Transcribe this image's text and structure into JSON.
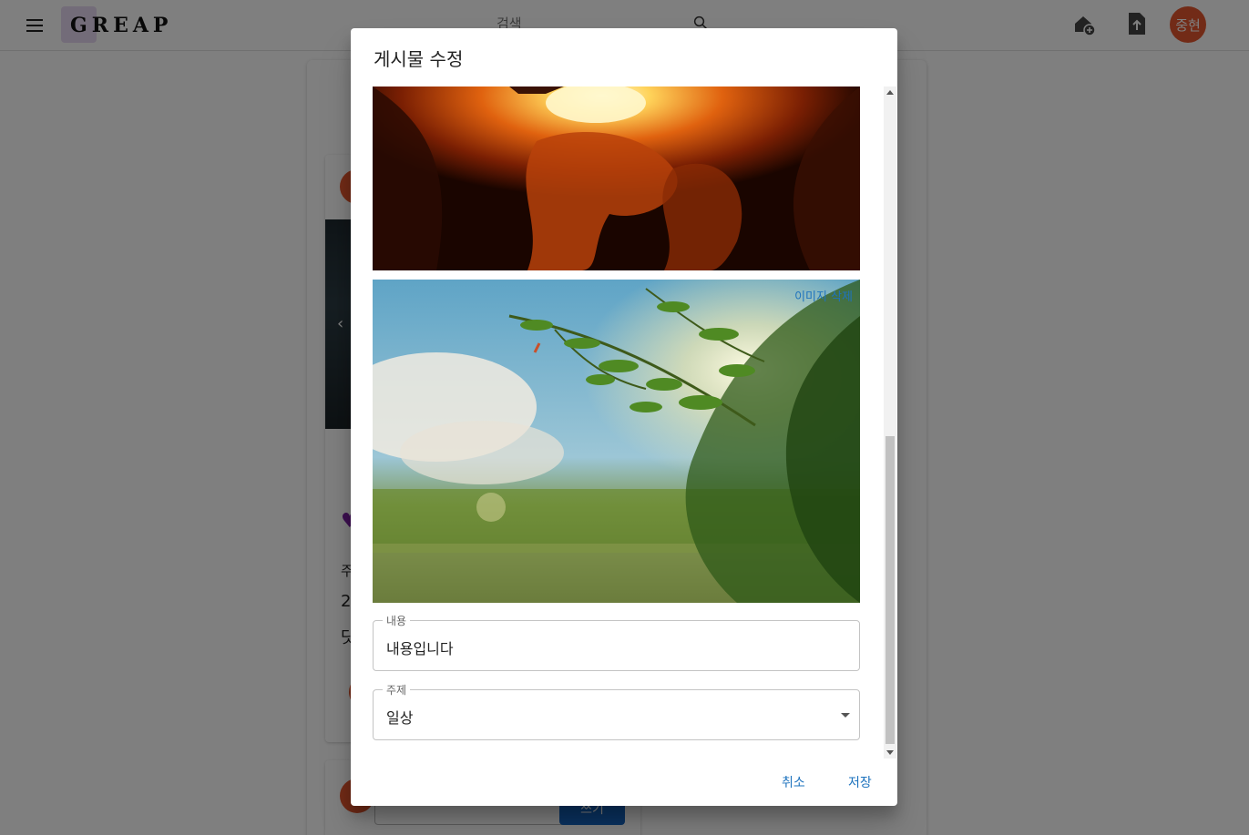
{
  "appbar": {
    "logo": "GREAP",
    "search_placeholder": "검색",
    "avatar_label": "중현"
  },
  "background": {
    "card_text_lines": [
      "주",
      "2",
      "닷"
    ],
    "comment_button": "쓰기"
  },
  "dialog": {
    "title": "게시물 수정",
    "image_delete_label": "이미지 삭제",
    "content_field": {
      "label": "내용",
      "value": "내용입니다"
    },
    "topic_field": {
      "label": "주제",
      "value": "일상"
    },
    "cancel_label": "취소",
    "save_label": "저장"
  },
  "colors": {
    "accent": "#1e73be",
    "avatar": "#e4572e",
    "logo_bg": "#e7d8f3"
  }
}
